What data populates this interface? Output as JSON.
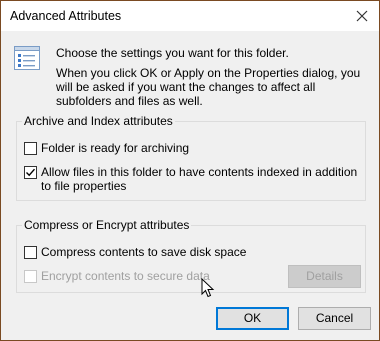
{
  "window": {
    "title": "Advanced Attributes"
  },
  "intro": {
    "line1": "Choose the settings you want for this folder.",
    "line2": "When you click OK or Apply on the Properties dialog, you will be asked if you want the changes to affect all subfolders and files as well."
  },
  "archive_group": {
    "title": "Archive and Index attributes",
    "archive_label": "Folder is ready for archiving",
    "archive_checked": false,
    "index_label": "Allow files in this folder to have contents indexed in addition to file properties",
    "index_checked": true
  },
  "compress_group": {
    "title": "Compress or Encrypt attributes",
    "compress_label": "Compress contents to save disk space",
    "compress_checked": false,
    "encrypt_label": "Encrypt contents to secure data",
    "encrypt_checked": false,
    "details_label": "Details"
  },
  "footer": {
    "ok_label": "OK",
    "cancel_label": "Cancel"
  },
  "icons": {
    "close": "close-icon",
    "settings": "settings-list-icon",
    "checkmark": "checkmark-icon",
    "cursor": "mouse-pointer-icon"
  },
  "colors": {
    "accent": "#0078d7",
    "border": "#7a4a22",
    "disabled_text": "#a0a0a0"
  }
}
